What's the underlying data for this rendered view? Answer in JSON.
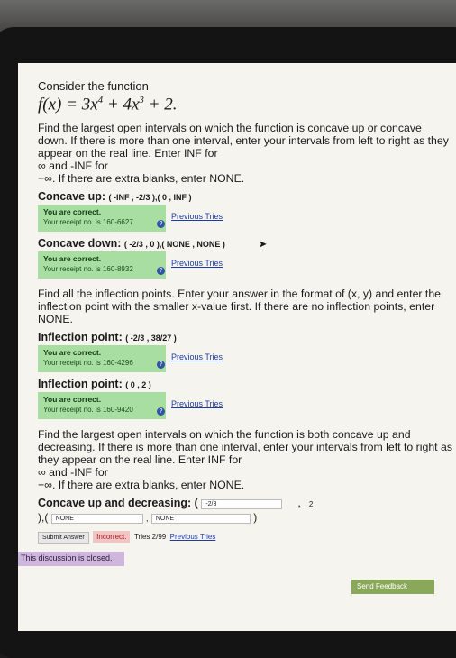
{
  "problem": {
    "intro": "Consider the function",
    "function_lhs": "f(x) = 3x",
    "function_exp1": "4",
    "function_mid": " + 4x",
    "function_exp2": "3",
    "function_tail": " + 2."
  },
  "part1": {
    "prompt": "Find the largest open intervals on which the function is concave up or concave down. If there is more than one interval, enter your intervals from left to right as they appear on the real line. Enter INF for",
    "inf_line": "∞ and -INF for",
    "neg_inf_line": "−∞. If there are extra blanks, enter NONE.",
    "concave_up_label": "Concave up:",
    "concave_up_answer": "( -INF , -2/3 ),( 0 , INF )",
    "concave_up_status": {
      "title": "You are correct.",
      "receipt": "Your receipt no. is 160-6627",
      "previous": "Previous Tries"
    },
    "concave_down_label": "Concave down:",
    "concave_down_answer": "( -2/3 , 0 ),( NONE , NONE )",
    "concave_down_status": {
      "title": "You are correct.",
      "receipt": "Your receipt no. is 160-8932",
      "previous": "Previous Tries"
    }
  },
  "part2": {
    "prompt": "Find all the inflection points. Enter your answer in the format of (x, y) and enter the inflection point with the smaller x-value first. If there are no inflection points, enter NONE.",
    "ip1_label": "Inflection point:",
    "ip1_answer": "( -2/3 , 38/27 )",
    "ip1_status": {
      "title": "You are correct.",
      "receipt": "Your receipt no. is 160-4296",
      "previous": "Previous Tries"
    },
    "ip2_label": "Inflection point:",
    "ip2_answer": "( 0 , 2 )",
    "ip2_status": {
      "title": "You are correct.",
      "receipt": "Your receipt no. is 160-9420",
      "previous": "Previous Tries"
    }
  },
  "part3": {
    "prompt": "Find the largest open intervals on which the function is both concave up and decreasing. If there is more than one interval, enter your intervals from left to right as they appear on the real line. Enter INF for",
    "inf_line": "∞ and -INF for",
    "neg_inf_line": "−∞. If there are extra blanks, enter NONE.",
    "label": "Concave up and decreasing:",
    "open_paren": "(",
    "input1": "-2/3",
    "comma1": ",",
    "right_value": "2",
    "row2_prefix": "),(",
    "input2": "NONE",
    "comma2": ",",
    "input3": "NONE",
    "close_paren": ")",
    "submit_label": "Submit Answer",
    "incorrect_label": "Incorrect.",
    "tries": "Tries 2/99",
    "previous": "Previous Tries"
  },
  "footer": {
    "closed": "This discussion is closed.",
    "feedback": "Send Feedback"
  }
}
